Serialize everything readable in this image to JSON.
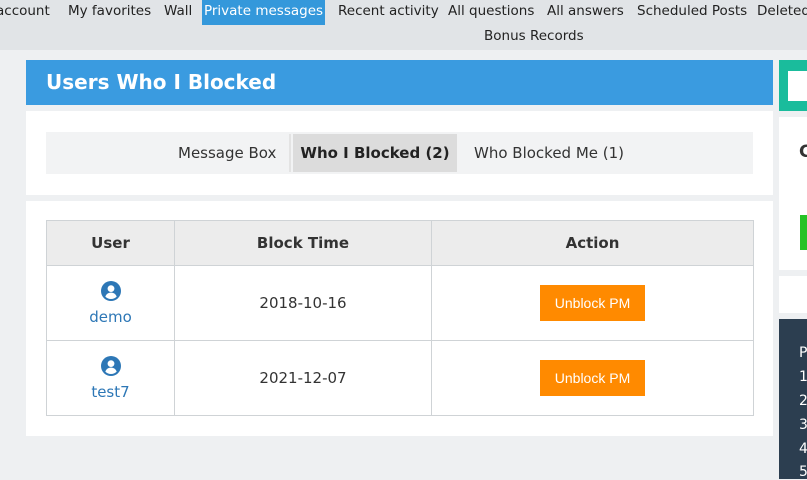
{
  "nav": {
    "items": [
      {
        "label": "account"
      },
      {
        "label": "My favorites"
      },
      {
        "label": "Wall"
      },
      {
        "label": "Private messages"
      },
      {
        "label": "Recent activity"
      },
      {
        "label": "All questions"
      },
      {
        "label": "All answers"
      },
      {
        "label": "Scheduled Posts"
      },
      {
        "label": "Deleted"
      },
      {
        "label": "Bonus Records"
      }
    ],
    "active_item": "Private messages"
  },
  "page": {
    "title": "Users Who I Blocked"
  },
  "tabs": [
    {
      "label": "Message Box"
    },
    {
      "label": "Who I Blocked (2)"
    },
    {
      "label": "Who Blocked Me (1)"
    }
  ],
  "active_tab": "Who I Blocked (2)",
  "table": {
    "headers": [
      "User",
      "Block Time",
      "Action"
    ],
    "rows": [
      {
        "user": "demo",
        "block_time": "2018-10-16",
        "action": "Unblock PM"
      },
      {
        "user": "test7",
        "block_time": "2021-12-07",
        "action": "Unblock PM"
      }
    ]
  },
  "sidebar": {
    "card_letter": "C",
    "list_header": "P",
    "list_numbers": [
      "1",
      "2",
      "3",
      "4",
      "5"
    ]
  },
  "colors": {
    "accent": "#3a9be0",
    "nav_active": "#3498db",
    "unblock_button": "#ff8a00",
    "link": "#2d77b6",
    "sidebar_teal": "#1abc9c",
    "sidebar_dark": "#2c3e50"
  },
  "icons": {
    "user": "user-circle-icon"
  }
}
